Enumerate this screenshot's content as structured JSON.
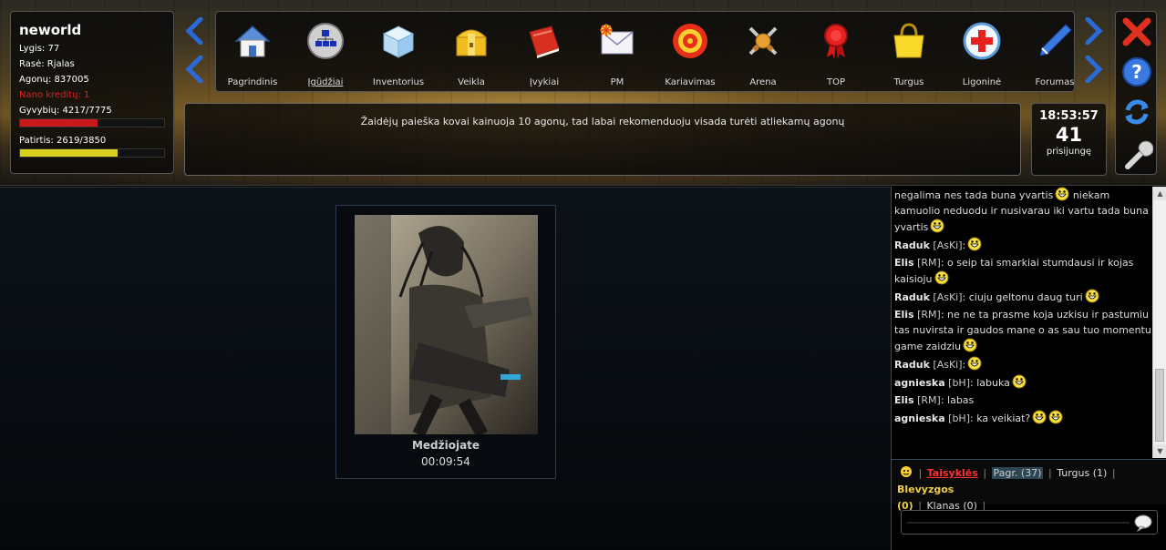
{
  "player": {
    "name": "neworld",
    "level": "Lygis: 77",
    "race": "Rasė: Rjalas",
    "agonai": "Agonų: 837005",
    "nano": "Nano kreditų: 1",
    "hp_text": "Gyvybių: 4217/7775",
    "hp_fraction": 0.54,
    "xp_text": "Patirtis: 2619/3850",
    "xp_fraction": 0.68
  },
  "nav": {
    "items": [
      {
        "label": "Pagrindinis",
        "icon": "home-icon"
      },
      {
        "label": "Įgūdžiai",
        "icon": "skills-icon"
      },
      {
        "label": "Inventorius",
        "icon": "inventory-box-icon"
      },
      {
        "label": "Veikla",
        "icon": "treasure-chest-icon"
      },
      {
        "label": "Įvykiai",
        "icon": "book-icon"
      },
      {
        "label": "PM",
        "icon": "mail-icon"
      },
      {
        "label": "Kariavimas",
        "icon": "target-icon"
      },
      {
        "label": "Arena",
        "icon": "crossed-swords-icon"
      },
      {
        "label": "TOP",
        "icon": "award-ribbon-icon"
      },
      {
        "label": "Turgus",
        "icon": "shopping-bag-icon"
      },
      {
        "label": "Ligoninė",
        "icon": "medical-cross-icon"
      },
      {
        "label": "Forumas",
        "icon": "pen-icon"
      }
    ]
  },
  "notice": "Žaidėjų paieška kovai kainuoja 10 agonų, tad labai rekomenduoju visada turėti atliekamų agonų",
  "clock": {
    "time": "18:53:57",
    "online_count": "41",
    "online_label": "prisijungę"
  },
  "hunt": {
    "title": "Medžiojate",
    "timer": "00:09:54"
  },
  "chat": {
    "messages": [
      {
        "nick": "",
        "clan": "",
        "text": "negalima nes tada buna yvartis",
        "smiles": 1,
        "cont": "niekam kamuolio neduodu ir nusivarau iki vartu tada buna yvartis",
        "smiles2": 1
      },
      {
        "nick": "Raduk",
        "clan": "[AsKi]",
        "text": ":",
        "smiles": 1
      },
      {
        "nick": "Elis",
        "clan": "[RM]",
        "text": ": o seip tai smarkiai stumdausi ir kojas kaisioju",
        "smiles": 1
      },
      {
        "nick": "Raduk",
        "clan": "[AsKi]",
        "text": ": ciuju geltonu daug turi",
        "smiles": 1
      },
      {
        "nick": "Elis",
        "clan": "[RM]",
        "text": ": ne ne ta prasme koja uzkisu ir pastumiu tas nuvirsta ir gaudos mane o as sau tuo momentu game zaidziu",
        "smiles": 1
      },
      {
        "nick": "Raduk",
        "clan": "[AsKi]",
        "text": ":",
        "smiles": 1
      },
      {
        "nick": "agnieska",
        "clan": "[bH]",
        "text": ": labuka",
        "smiles": 1
      },
      {
        "nick": "Elis",
        "clan": "[RM]",
        "text": ": labas",
        "smiles": 0
      },
      {
        "nick": "agnieska",
        "clan": "[bH]",
        "text": ": ka veikiat?",
        "smiles": 2
      }
    ],
    "channels": {
      "rules": "Taisyklės",
      "main": "Pagr. (37)",
      "market": "Turgus (1)",
      "spam": "Blevyzgos",
      "spam_count": "(0)",
      "clan": "Klanas (0)"
    },
    "input_placeholder": ""
  },
  "colors": {
    "accent_blue": "#1e5fc8",
    "hp": "#c8181c",
    "xp": "#d8d020",
    "rules": "#ff3030"
  }
}
